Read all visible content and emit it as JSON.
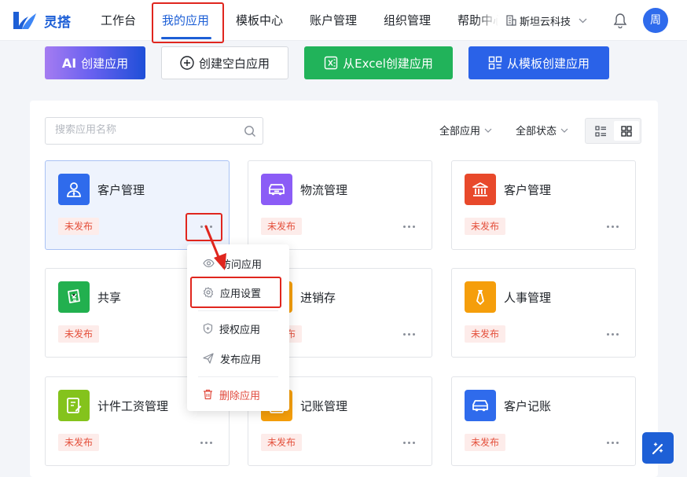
{
  "app": {
    "name": "灵搭"
  },
  "nav": {
    "items": [
      {
        "label": "工作台",
        "active": false
      },
      {
        "label": "我的应用",
        "active": true
      },
      {
        "label": "模板中心",
        "active": false
      },
      {
        "label": "账户管理",
        "active": false
      },
      {
        "label": "组织管理",
        "active": false
      },
      {
        "label": "帮助中心",
        "active": false
      }
    ],
    "org_name": "斯坦云科技",
    "user_initial": "周"
  },
  "actions": {
    "ai_mark": "AI",
    "ai_label": "创建应用",
    "blank_label": "创建空白应用",
    "excel_label": "从Excel创建应用",
    "template_label": "从模板创建应用"
  },
  "toolbar": {
    "search_placeholder": "搜索应用名称",
    "filter_apps": "全部应用",
    "filter_status": "全部状态"
  },
  "cards": [
    {
      "title": "客户管理",
      "status": "未发布",
      "icon": "customer-icon",
      "color": "#2f6bec"
    },
    {
      "title": "物流管理",
      "status": "未发布",
      "icon": "truck-icon",
      "color": "#8b5cf6"
    },
    {
      "title": "客户管理",
      "status": "未发布",
      "icon": "bank-icon",
      "color": "#e8492b"
    },
    {
      "title": "共享",
      "status": "未发布",
      "icon": "money-icon",
      "color": "#22b04f"
    },
    {
      "title": "进销存",
      "status": "未发布",
      "icon": "box-icon",
      "color": "#f59e0b"
    },
    {
      "title": "人事管理",
      "status": "未发布",
      "icon": "tie-icon",
      "color": "#f59e0b"
    },
    {
      "title": "计件工资管理",
      "status": "未发布",
      "icon": "edit-icon",
      "color": "#84c31c"
    },
    {
      "title": "记账管理",
      "status": "未发布",
      "icon": "ledger-icon",
      "color": "#f59e0b"
    },
    {
      "title": "客户记账",
      "status": "未发布",
      "icon": "car-icon",
      "color": "#2f6bec"
    }
  ],
  "menu": [
    {
      "label": "访问应用",
      "icon": "eye-icon"
    },
    {
      "label": "应用设置",
      "icon": "settings-icon"
    },
    {
      "label": "授权应用",
      "icon": "shield-icon"
    },
    {
      "label": "发布应用",
      "icon": "send-icon"
    },
    {
      "label": "删除应用",
      "icon": "trash-icon"
    }
  ],
  "colors": {
    "primary": "#1d5fd6",
    "annotation": "#e0261e",
    "badge_text": "#e4503c",
    "danger": "#e14a3d"
  }
}
